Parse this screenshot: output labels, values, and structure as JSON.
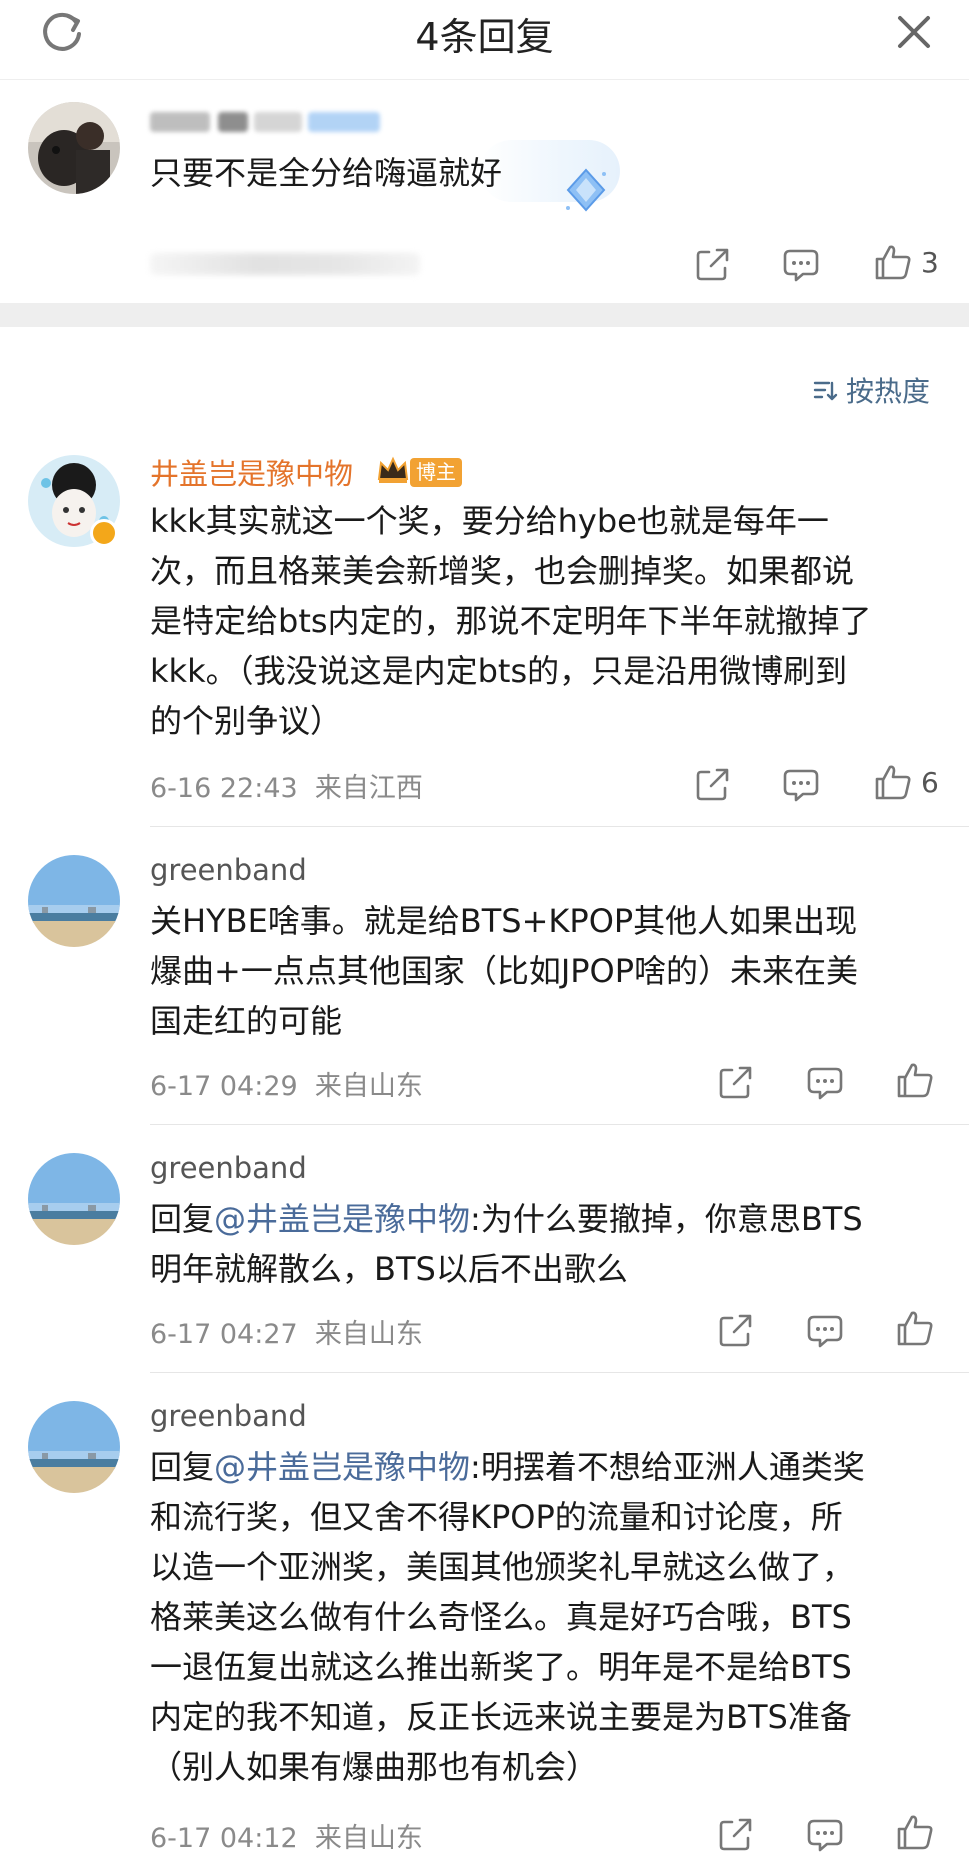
{
  "header": {
    "title": "4条回复"
  },
  "parent_comment": {
    "text": "只要不是全分给嗨逼就好",
    "like_count": "3"
  },
  "sort": {
    "label": "按热度"
  },
  "replies": [
    {
      "author": "井盖岂是豫中物",
      "badge": "博主",
      "text_lines": [
        "kkk其实就这一个奖，要分给hybe也就是每年一",
        "次，而且格莱美会新增奖，也会删掉奖。如果都说",
        "是特定给bts内定的，那说不定明年下半年就撤掉了",
        "kkk。（我没说这是内定bts的，只是沿用微博刷到",
        "的个别争议）"
      ],
      "time": "6-16 22:43",
      "location": "来自江西",
      "like_count": "6"
    },
    {
      "author": "greenband",
      "text_lines": [
        "关HYBE啥事。就是给BTS+KPOP其他人如果出现",
        "爆曲+一点点其他国家（比如JPOP啥的）未来在美",
        "国走红的可能"
      ],
      "time": "6-17 04:29",
      "location": "来自山东"
    },
    {
      "author": "greenband",
      "reply_prefix": "回复",
      "mention": "@井盖岂是豫中物",
      "text_first": ":为什么要撤掉，你意思BTS",
      "text_lines": [
        "明年就解散么，BTS以后不出歌么"
      ],
      "time": "6-17 04:27",
      "location": "来自山东"
    },
    {
      "author": "greenband",
      "reply_prefix": "回复",
      "mention": "@井盖岂是豫中物",
      "text_first": ":明摆着不想给亚洲人通类奖",
      "text_lines": [
        "和流行奖，但又舍不得KPOP的流量和讨论度，所",
        "以造一个亚洲奖，美国其他颁奖礼早就这么做了，",
        "格莱美这么做有什么奇怪么。真是好巧合哦，BTS",
        "一退伍复出就这么推出新奖了。明年是不是给BTS",
        "内定的我不知道，反正长远来说主要是为BTS准备",
        "（别人如果有爆曲那也有机会）"
      ],
      "time": "6-17 04:12",
      "location": "来自山东"
    }
  ]
}
